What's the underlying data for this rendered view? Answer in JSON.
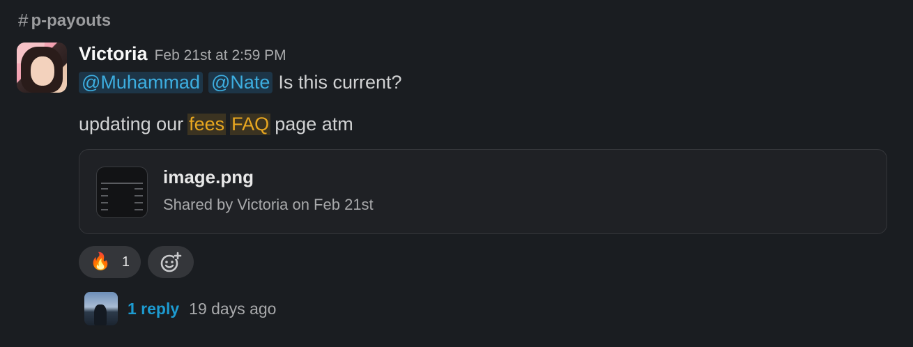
{
  "channel": {
    "hash": "#",
    "name": "p-payouts"
  },
  "message": {
    "author": "Victoria",
    "timestamp": "Feb 21st at 2:59 PM",
    "mentions": [
      "@Muhammad",
      "@Nate"
    ],
    "line1_text": "Is this current?",
    "line2": {
      "before": "updating our",
      "keyword1": "fees",
      "keyword2": "FAQ",
      "after": "page atm"
    },
    "attachment": {
      "filename": "image.png",
      "shared_by": "Shared by Victoria on Feb 21st",
      "thumb_icon": "spreadsheet-thumbnail"
    },
    "reactions": [
      {
        "emoji": "🔥",
        "icon": "fire-emoji",
        "count": "1"
      }
    ],
    "add_reaction_icon": "add-emoji-icon",
    "thread": {
      "reply_label": "1 reply",
      "last_reply": "19 days ago"
    }
  },
  "colors": {
    "background": "#1a1d21",
    "mention": "#3daee0",
    "keyword_highlight": "#e8a720",
    "link": "#1d9bd1"
  }
}
